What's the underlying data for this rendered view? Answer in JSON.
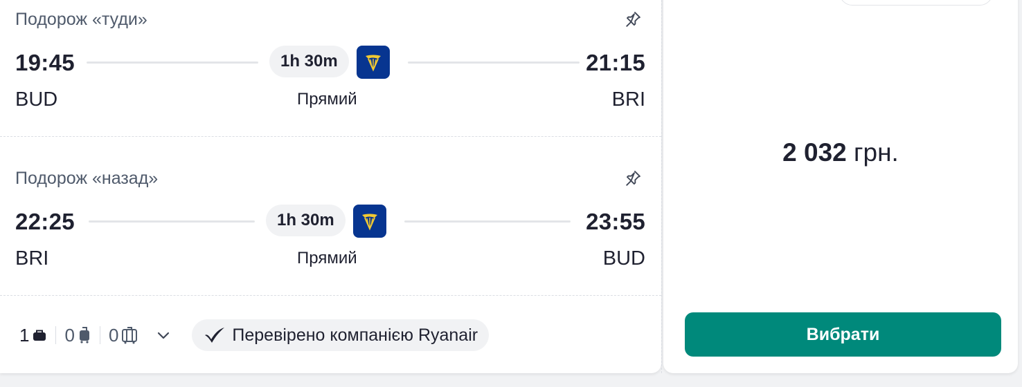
{
  "outbound": {
    "title": "Подорож «туди»",
    "depart_time": "19:45",
    "arrive_time": "21:15",
    "duration": "1h 30m",
    "from": "BUD",
    "to": "BRI",
    "stops": "Прямий"
  },
  "inbound": {
    "title": "Подорож «назад»",
    "depart_time": "22:25",
    "arrive_time": "23:55",
    "duration": "1h 30m",
    "from": "BRI",
    "to": "BUD",
    "stops": "Прямий"
  },
  "baggage": {
    "personal_item": "1",
    "cabin_bag": "0",
    "checked_bag": "0"
  },
  "verified_label": "Перевірено компанією Ryanair",
  "price": {
    "amount": "2 032",
    "currency": "грн."
  },
  "select_label": "Вибрати",
  "colors": {
    "accent": "#00897b",
    "airline_logo_bg": "#073590",
    "airline_logo_fg": "#f1c933"
  },
  "icons": {
    "pin": "pin-icon",
    "airline": "ryanair-logo",
    "personal_item": "bag-icon",
    "cabin_bag": "cabin-bag-icon",
    "checked_bag": "suitcase-icon",
    "expand": "chevron-down-icon",
    "verified": "checkmark-icon"
  }
}
